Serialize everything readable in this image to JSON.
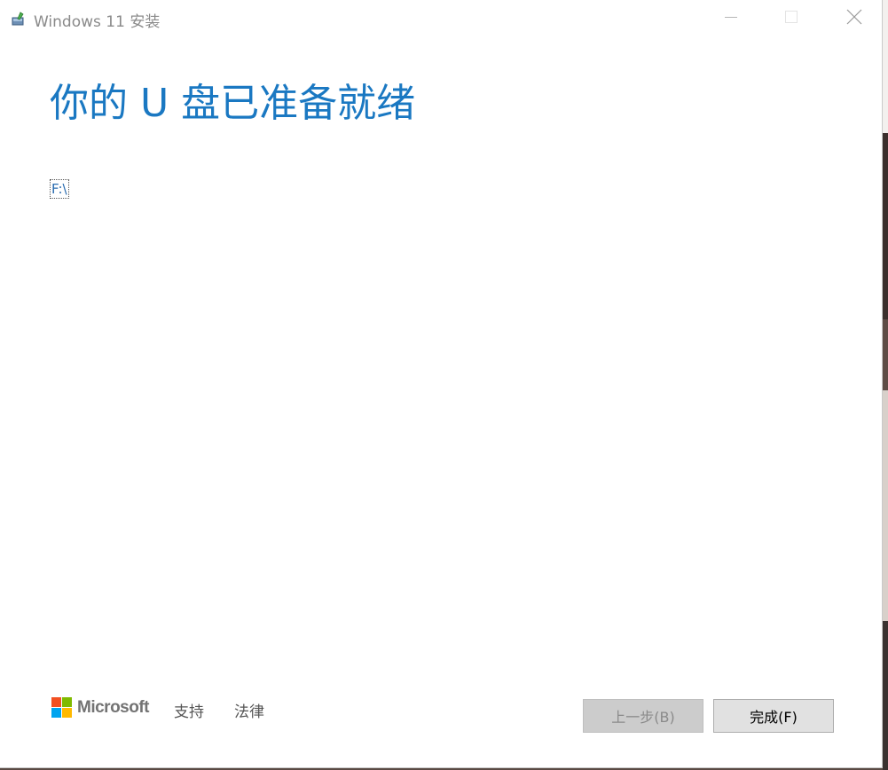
{
  "window": {
    "title": "Windows 11 安装",
    "icon": "setup-installer-icon",
    "controls": {
      "minimize_icon": "minimize-icon",
      "maximize_icon": "maximize-icon",
      "close_icon": "close-icon"
    }
  },
  "main": {
    "heading": "你的 U 盘已准备就绪",
    "drive_path": "F:\\"
  },
  "footer": {
    "brand": "Microsoft",
    "brand_colors": [
      "#f25022",
      "#7fba00",
      "#00a4ef",
      "#ffb900"
    ],
    "links": {
      "support": "支持",
      "legal": "法律"
    },
    "buttons": {
      "back": "上一步(B)",
      "finish": "完成(F)"
    }
  },
  "colors": {
    "accent": "#1a78c2",
    "disabled_button": "#cccccc",
    "default_button": "#e1e1e1"
  }
}
